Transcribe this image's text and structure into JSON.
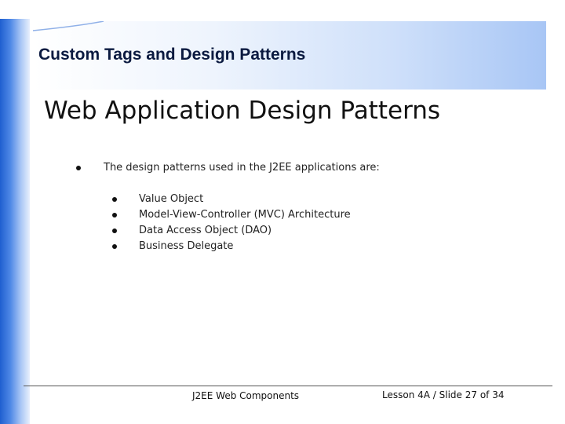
{
  "header": {
    "title": "Custom Tags and Design Patterns"
  },
  "slide": {
    "title": "Web Application Design Patterns",
    "bullet": "The design patterns used in the J2EE applications are:",
    "sub_bullets": [
      "Value Object",
      "Model-View-Controller (MVC) Architecture",
      "Data Access Object (DAO)",
      "Business Delegate"
    ]
  },
  "footer": {
    "course": "J2EE Web Components",
    "lesson": "Lesson 4A / Slide 27 of 34"
  },
  "colors": {
    "accent_blue": "#1f5fd0",
    "header_text": "#0b1a40"
  }
}
